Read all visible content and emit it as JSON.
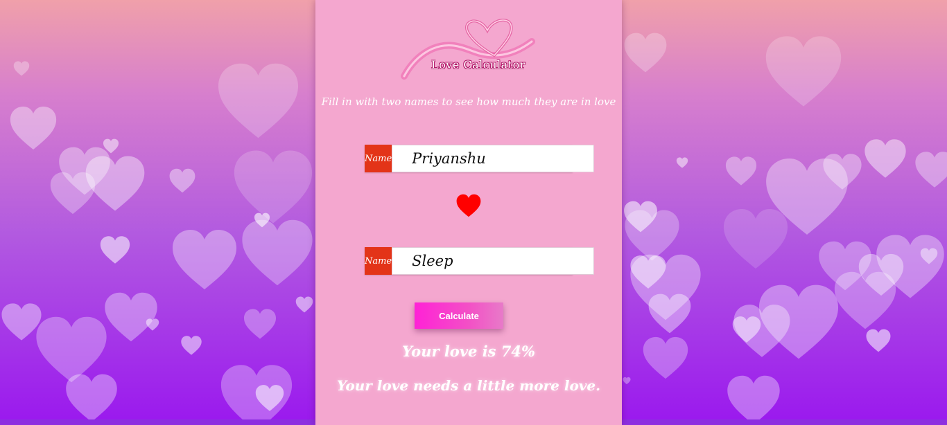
{
  "app": {
    "logo_text": "Love Calculator",
    "intro": "Fill in with two names to see how much they are in love"
  },
  "form": {
    "name1_label": "Name",
    "name1_value": "Priyanshu",
    "name2_label": "Name",
    "name2_value": "Sleep",
    "calculate_label": "Calculate"
  },
  "result": {
    "percent_text": "Your love is 74%",
    "message": "Your love needs a little more love."
  },
  "icons": {
    "logo": "ribbon-heart-icon",
    "separator": "heart-icon"
  },
  "colors": {
    "panel": "#f4a7cf",
    "label": "#e33418",
    "heart": "#ff0000",
    "button": "#ff22d6"
  }
}
